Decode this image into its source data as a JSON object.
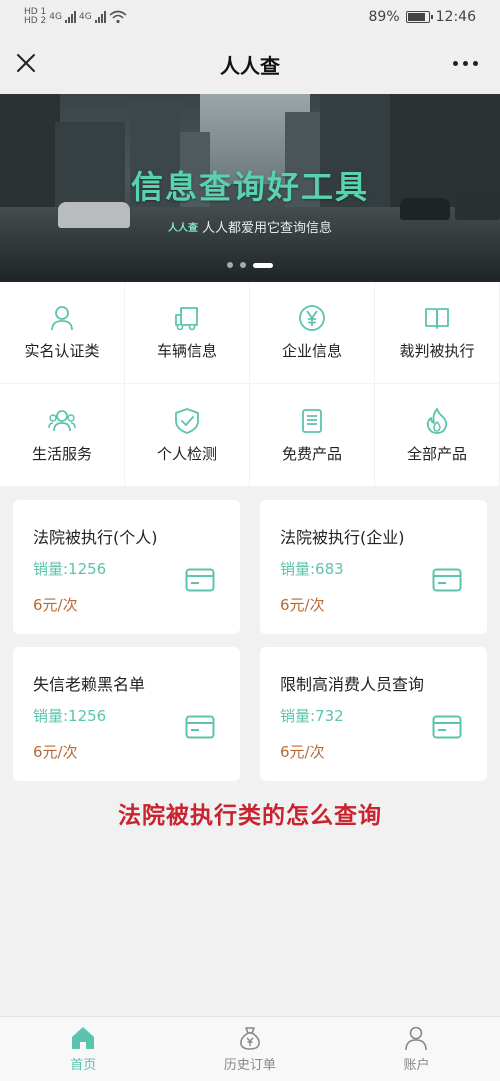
{
  "status_bar": {
    "sim1": "HD 1",
    "sim2": "HD 2",
    "net1": "4G",
    "net2": "4G",
    "battery": "89%",
    "battery_level": 0.89,
    "time": "12:46"
  },
  "nav": {
    "title": "人人查",
    "close_icon": "close-icon",
    "more_icon": "more-icon"
  },
  "banner": {
    "title": "信息查询好工具",
    "logo": "人人查",
    "subtitle": "人人都爱用它查询信息",
    "slides": 3,
    "active_slide": 3
  },
  "categories": [
    {
      "label": "实名认证类",
      "icon": "person-icon"
    },
    {
      "label": "车辆信息",
      "icon": "truck-icon"
    },
    {
      "label": "企业信息",
      "icon": "yen-icon"
    },
    {
      "label": "裁判被执行",
      "icon": "book-icon"
    },
    {
      "label": "生活服务",
      "icon": "people-icon"
    },
    {
      "label": "个人检测",
      "icon": "shield-check-icon"
    },
    {
      "label": "免费产品",
      "icon": "document-icon"
    },
    {
      "label": "全部产品",
      "icon": "flame-icon"
    }
  ],
  "products": [
    {
      "title": "法院被执行(个人)",
      "sales": "销量:1256",
      "price": "6元/次",
      "icon": "card-icon"
    },
    {
      "title": "法院被执行(企业)",
      "sales": "销量:683",
      "price": "6元/次",
      "icon": "card-icon"
    },
    {
      "title": "失信老赖黑名单",
      "sales": "销量:1256",
      "price": "6元/次",
      "icon": "card-icon"
    },
    {
      "title": "限制高消费人员查询",
      "sales": "销量:732",
      "price": "6元/次",
      "icon": "card-icon"
    }
  ],
  "caption": "法院被执行类的怎么查询",
  "tabbar": [
    {
      "label": "首页",
      "icon": "home-icon",
      "active": true
    },
    {
      "label": "历史订单",
      "icon": "money-bag-icon",
      "active": false
    },
    {
      "label": "账户",
      "icon": "user-icon",
      "active": false
    }
  ],
  "colors": {
    "accent": "#5cc3ac",
    "price": "#b86a36",
    "caption": "#c8232f",
    "banner_title": "#58d3b0"
  }
}
